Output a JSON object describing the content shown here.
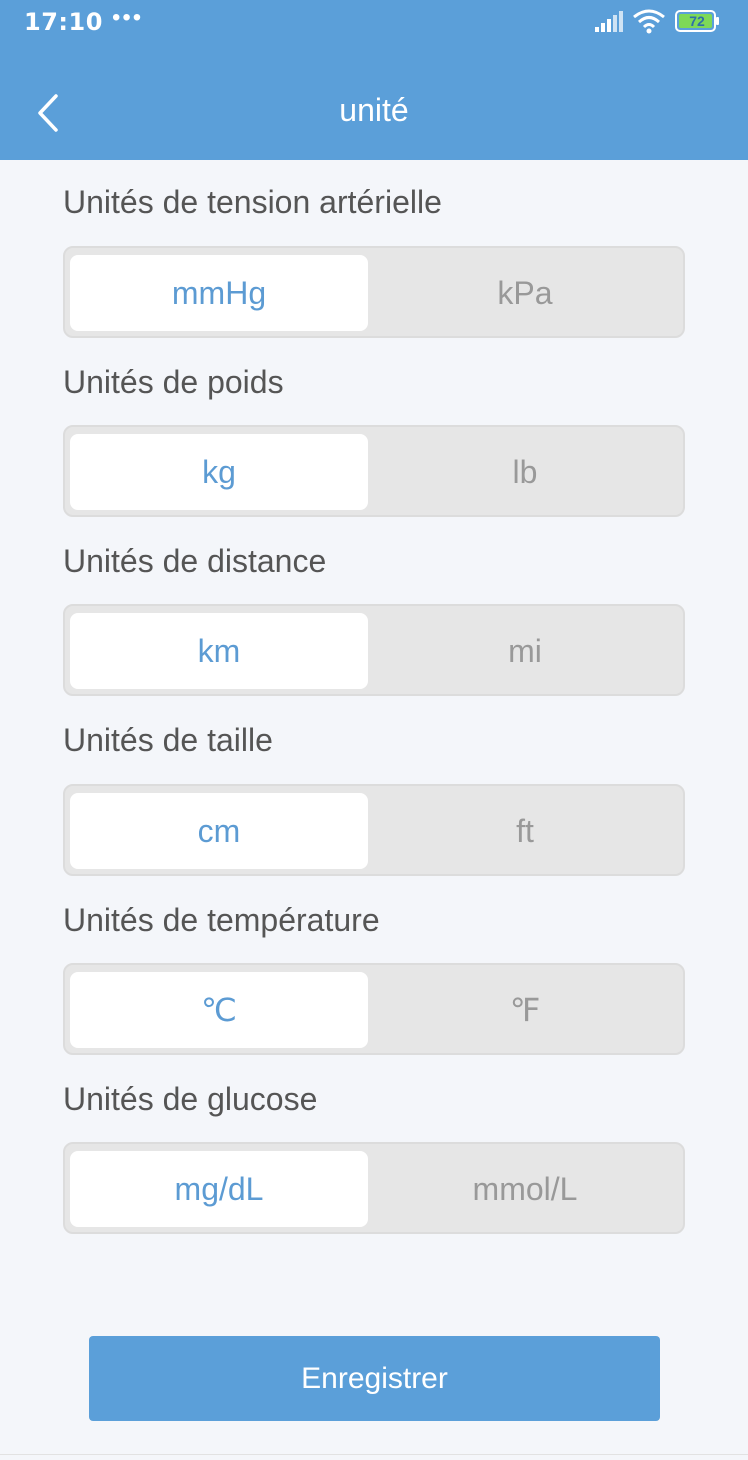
{
  "status_bar": {
    "time": "17:10",
    "dots": "•••",
    "battery": "72"
  },
  "header": {
    "title": "unité"
  },
  "sections": [
    {
      "label": "Unités de tension artérielle",
      "options": [
        "mmHg",
        "kPa"
      ],
      "selected": 0
    },
    {
      "label": "Unités de poids",
      "options": [
        "kg",
        "lb"
      ],
      "selected": 0
    },
    {
      "label": "Unités de distance",
      "options": [
        "km",
        "mi"
      ],
      "selected": 0
    },
    {
      "label": "Unités de taille",
      "options": [
        "cm",
        "ft"
      ],
      "selected": 0
    },
    {
      "label": "Unités de température",
      "options": [
        "℃",
        "℉"
      ],
      "selected": 0
    },
    {
      "label": "Unités de glucose",
      "options": [
        "mg/dL",
        "mmol/L"
      ],
      "selected": 0
    }
  ],
  "save_label": "Enregistrer",
  "colors": {
    "header": "#5b9fd9",
    "selected_text": "#5c9bd3",
    "unselected_text": "#999999"
  }
}
